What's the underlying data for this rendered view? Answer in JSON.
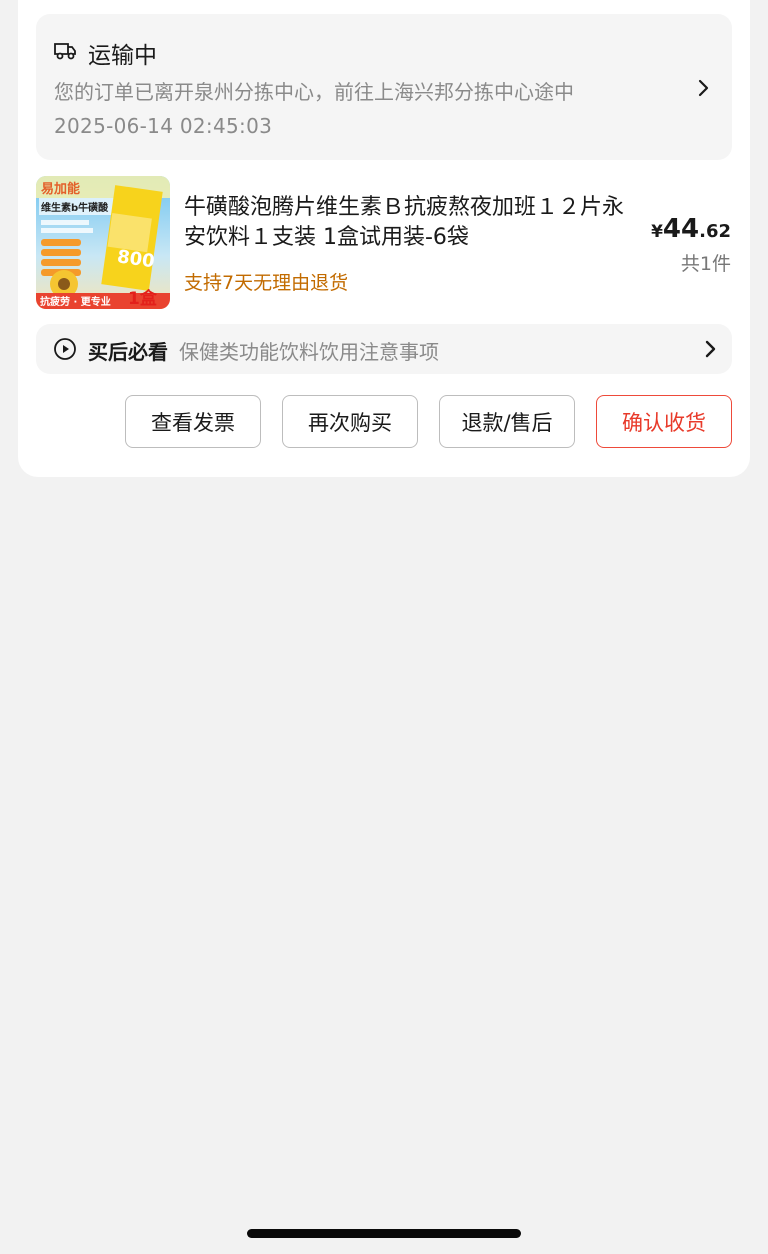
{
  "order": {
    "logistics": {
      "status": "运输中",
      "description": "您的订单已离开泉州分拣中心，前往上海兴邦分拣中心途中",
      "time": "2025-06-14 02:45:03"
    },
    "product": {
      "title": "牛磺酸泡腾片维生素Ｂ抗疲熬夜加班１２片永安饮料１支装 1盒试用装-6袋",
      "return_policy": "支持7天无理由退货",
      "price_currency": "¥",
      "price_integer": "44",
      "price_decimal": ".62",
      "quantity": "共1件",
      "image_text": {
        "brand": "易加能",
        "line1": "维生素b牛磺酸",
        "big_number": "800",
        "box": "1盒",
        "bottom_tag": "抗疲劳 · 更专业"
      }
    },
    "guide": {
      "title": "买后必看",
      "description": "保健类功能饮料饮用注意事项"
    },
    "actions": {
      "invoice": "查看发票",
      "rebuy": "再次购买",
      "refund": "退款/售后",
      "confirm": "确认收货"
    }
  },
  "colors": {
    "accent_red": "#e83a2a",
    "orange_text": "#c26b00",
    "background": "#f2f2f2"
  },
  "icons": [
    "truck-icon",
    "chevron-right-icon",
    "play-circle-icon"
  ]
}
